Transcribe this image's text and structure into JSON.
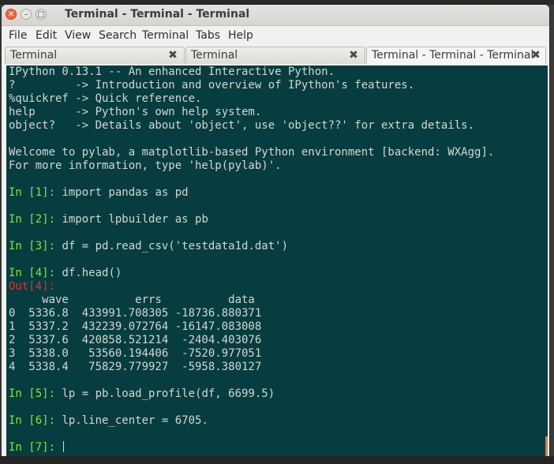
{
  "window": {
    "title": "Terminal - Terminal - Terminal",
    "close_glyph": "✕",
    "minimize_glyph": "–",
    "maximize_glyph": "□"
  },
  "menubar": {
    "items": [
      "File",
      "Edit",
      "View",
      "Search",
      "Terminal",
      "Tabs",
      "Help"
    ]
  },
  "tabs": [
    {
      "label": "Terminal",
      "close_glyph": "✖",
      "active": false
    },
    {
      "label": "Terminal",
      "close_glyph": "✖",
      "active": false
    },
    {
      "label": "Terminal - Terminal - Terminal",
      "close_glyph": "✖",
      "active": true
    }
  ],
  "terminal": {
    "colors": {
      "background": "#073d40",
      "text": "#d3d7cf",
      "in_prompt": "#8ae234",
      "out_prompt": "#ef2929"
    },
    "banner": [
      "IPython 0.13.1 -- An enhanced Interactive Python.",
      "?         -> Introduction and overview of IPython's features.",
      "%quickref -> Quick reference.",
      "help      -> Python's own help system.",
      "object?   -> Details about 'object', use 'object??' for extra details."
    ],
    "welcome": [
      "Welcome to pylab, a matplotlib-based Python environment [backend: WXAgg].",
      "For more information, type 'help(pylab)'."
    ],
    "cells": [
      {
        "prompt": "In [1]:",
        "code": " import pandas as pd"
      },
      {
        "prompt": "In [2]:",
        "code": " import lpbuilder as pb"
      },
      {
        "prompt": "In [3]:",
        "code": " df = pd.read_csv('testdata1d.dat')"
      },
      {
        "prompt": "In [4]:",
        "code": " df.head()"
      }
    ],
    "out4_prompt": "Out[4]:",
    "table_lines": [
      "     wave          errs          data",
      "0  5336.8  433991.708305 -18736.880371",
      "1  5337.2  432239.072764 -16147.083008",
      "2  5337.6  420858.521214  -2404.403076",
      "3  5338.0   53560.194406  -7520.977051",
      "4  5338.4   75829.779927  -5958.380127"
    ],
    "cells_after": [
      {
        "prompt": "In [5]:",
        "code": " lp = pb.load_profile(df, 6699.5)"
      },
      {
        "prompt": "In [6]:",
        "code": " lp.line_center = 6705."
      },
      {
        "prompt": "In [7]:",
        "code": " "
      }
    ]
  }
}
